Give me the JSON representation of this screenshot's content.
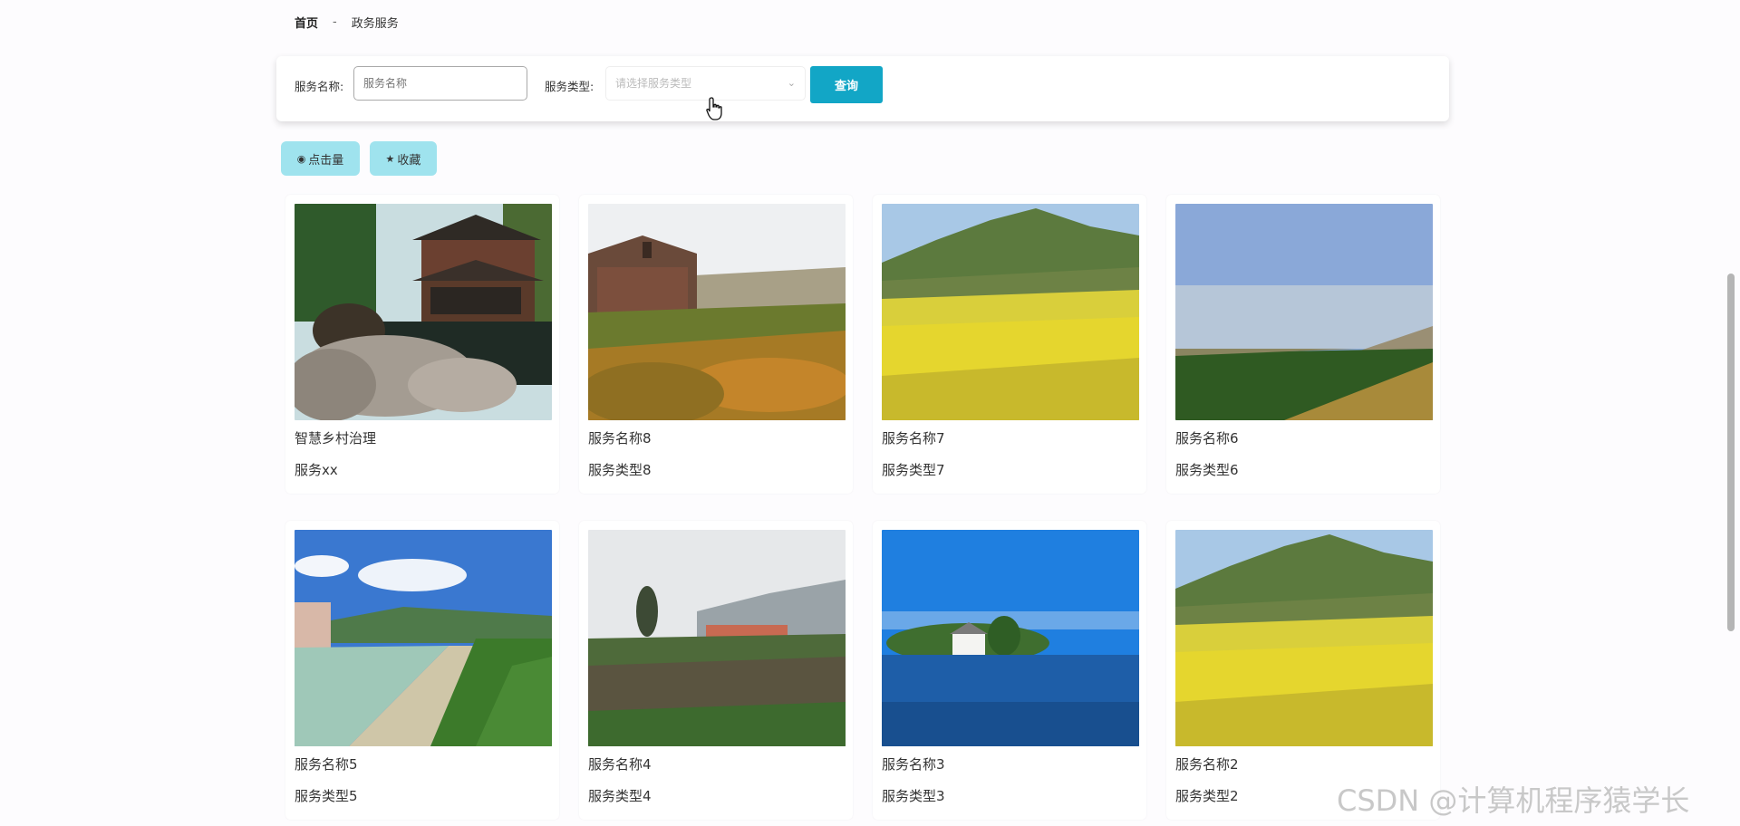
{
  "breadcrumb": {
    "home": "首页",
    "separator": "-",
    "current": "政务服务"
  },
  "search": {
    "name_label": "服务名称:",
    "name_placeholder": "服务名称",
    "type_label": "服务类型:",
    "type_placeholder": "请选择服务类型",
    "query_label": "查询"
  },
  "sort_buttons": {
    "clicks": "点击量",
    "favorites": "收藏"
  },
  "accent_color": "#12a6c6",
  "cards": [
    {
      "name": "智慧乡村治理",
      "type": "服务xx",
      "image": "wooden-house-by-pond"
    },
    {
      "name": "服务名称8",
      "type": "服务类型8",
      "image": "stone-house-vineyard"
    },
    {
      "name": "服务名称7",
      "type": "服务类型7",
      "image": "mountain-rapeseed-field"
    },
    {
      "name": "服务名称6",
      "type": "服务类型6",
      "image": "green-field-blue-sky"
    },
    {
      "name": "服务名称5",
      "type": "服务类型5",
      "image": "village-canal-road"
    },
    {
      "name": "服务名称4",
      "type": "服务类型4",
      "image": "misty-farm-village"
    },
    {
      "name": "服务名称3",
      "type": "服务类型3",
      "image": "lake-house-island"
    },
    {
      "name": "服务名称2",
      "type": "服务类型2",
      "image": "mountain-rapeseed-field"
    }
  ],
  "watermark": "CSDN @计算机程序猿学长"
}
